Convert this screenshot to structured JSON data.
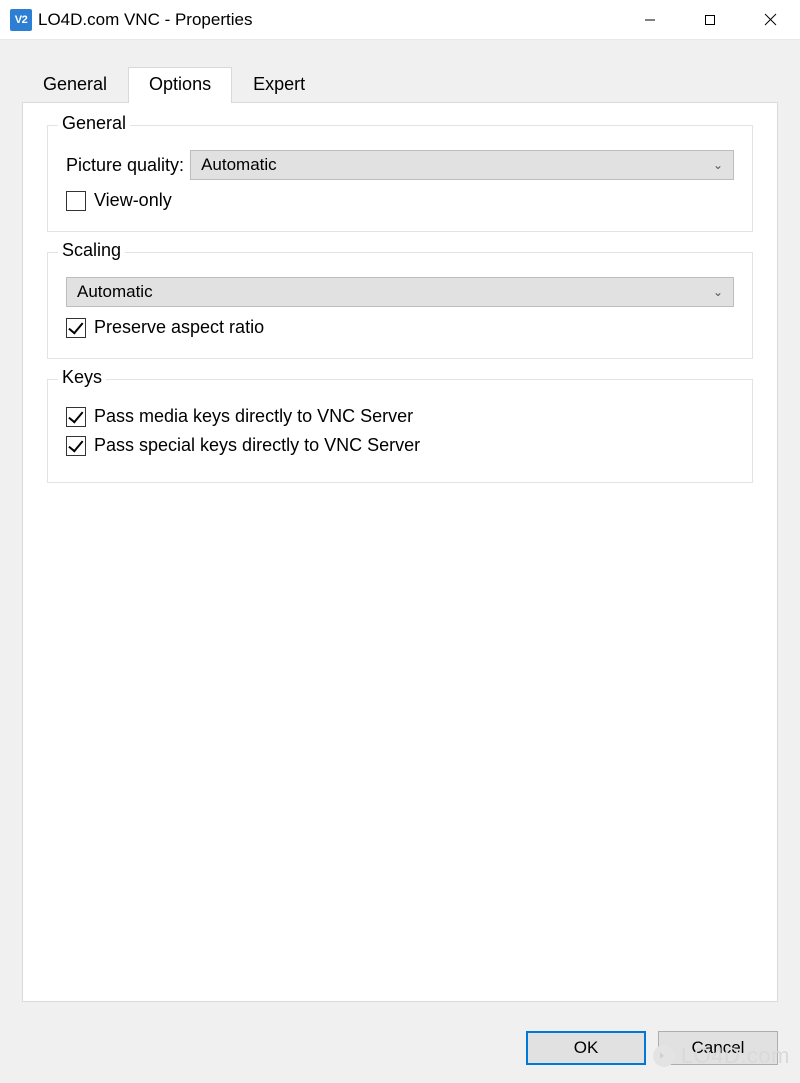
{
  "window": {
    "title": "LO4D.com VNC - Properties",
    "app_icon_text": "V2"
  },
  "tabs": {
    "general": "General",
    "options": "Options",
    "expert": "Expert",
    "active": "options"
  },
  "groups": {
    "general": {
      "legend": "General",
      "picture_quality_label": "Picture quality:",
      "picture_quality_value": "Automatic",
      "view_only_label": "View-only",
      "view_only_checked": false
    },
    "scaling": {
      "legend": "Scaling",
      "scaling_value": "Automatic",
      "preserve_label": "Preserve aspect ratio",
      "preserve_checked": true
    },
    "keys": {
      "legend": "Keys",
      "media_label": "Pass media keys directly to VNC Server",
      "media_checked": true,
      "special_label": "Pass special keys directly to VNC Server",
      "special_checked": true
    }
  },
  "buttons": {
    "ok": "OK",
    "cancel": "Cancel"
  },
  "watermark": "LO4D.com"
}
